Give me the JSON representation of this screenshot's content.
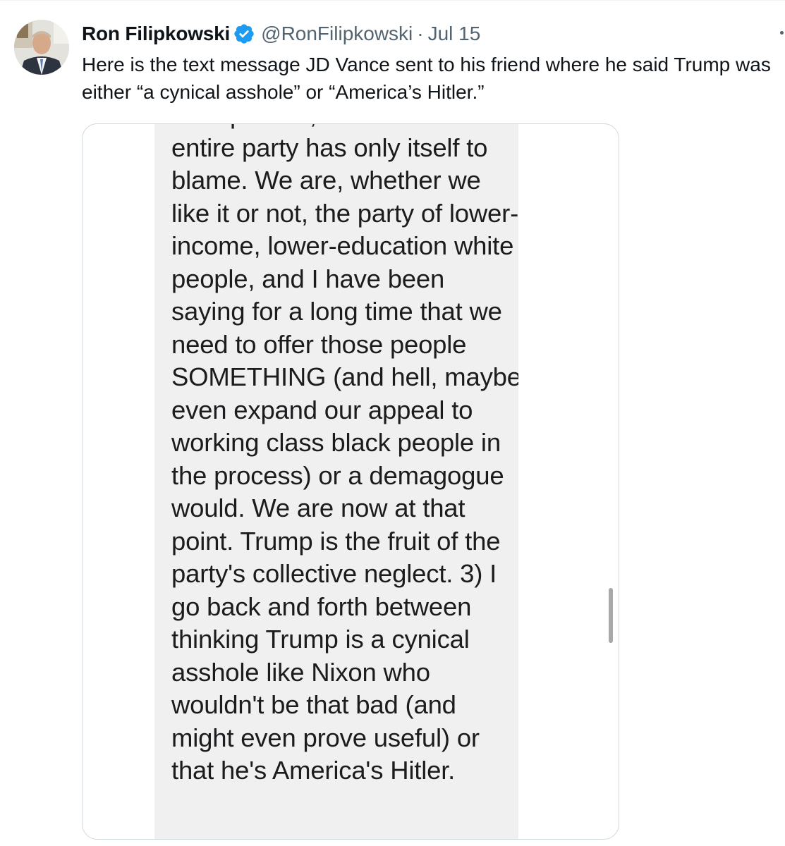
{
  "tweet": {
    "author": {
      "display_name": "Ron Filipkowski",
      "verified": true,
      "verified_color": "#1d9bf0",
      "handle": "@RonFilipkowski",
      "separator": "·",
      "timestamp": "Jul 15"
    },
    "text": "Here is the text message JD Vance sent to his friend where he said Trump was either “a cynical asshole” or “America’s Hitler.”",
    "media": {
      "message_text": "Trump's rise, and I think the\nentire party has only itself to blame.  We are, whether we like it or not, the party of lower-income, lower-education white people, and I have been saying for a long time that we need to offer those people SOMETHING (and hell, maybe even expand our appeal to working class black people in the process) or a demagogue would.  We are now at that point.  Trump is the fruit of the party's collective neglect.  3) I go back and forth between thinking Trump is a cynical asshole like Nixon who wouldn't be that bad (and might even prove useful) or\nthat he's America's Hitler."
    }
  }
}
